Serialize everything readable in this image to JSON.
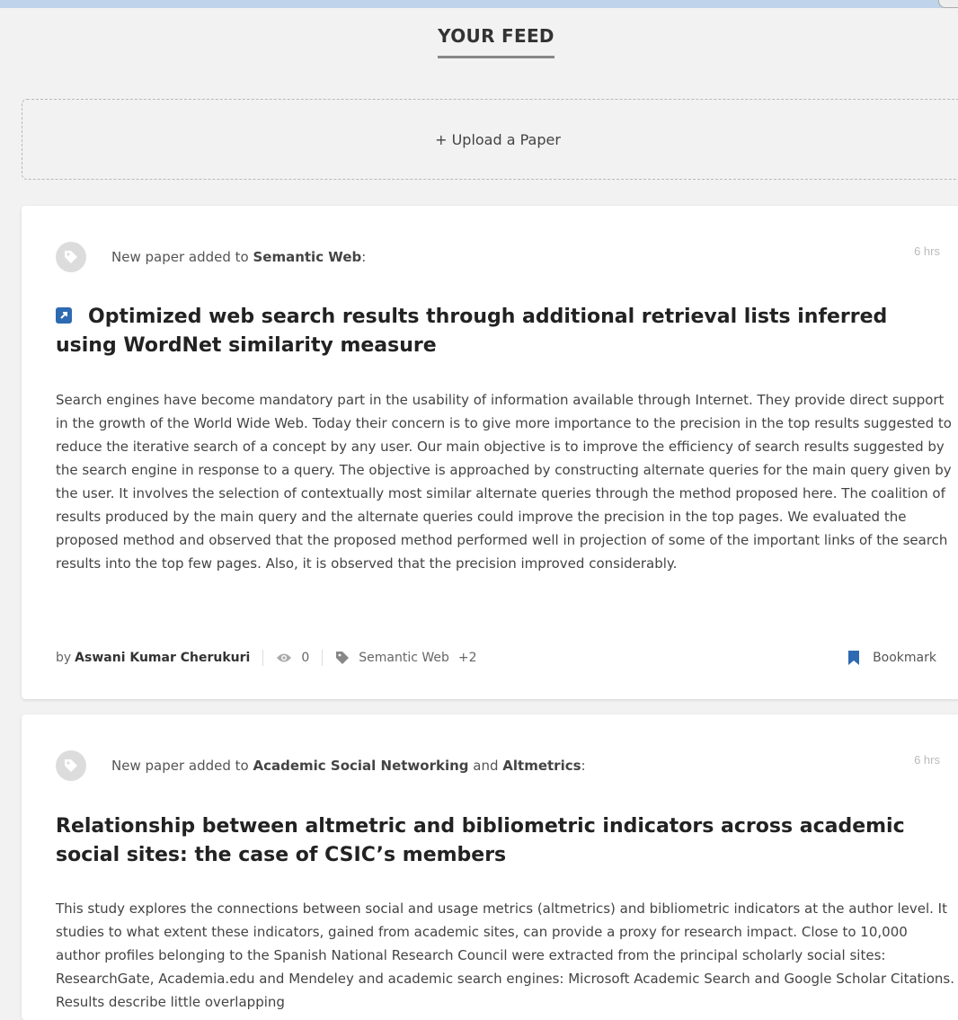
{
  "feed": {
    "title": "YOUR FEED"
  },
  "upload": {
    "label": "+ Upload a Paper"
  },
  "posts": [
    {
      "notice_prefix": "New paper added to ",
      "topics": [
        "Semantic Web"
      ],
      "notice_joiner": " and ",
      "notice_suffix": ":",
      "time": "6 hrs",
      "title": "Optimized web search results through additional retrieval lists inferred using WordNet similarity measure",
      "abstract": "Search engines have become mandatory part in the usability of information available through Internet. They provide direct support in the growth of the World Wide Web. Today their concern is to give more importance to the precision in the top results suggested to reduce the iterative search of a concept by any user. Our main objective is to improve the efficiency of search results suggested by the search engine in response to a query. The objective is approached by constructing alternate queries for the main query given by the user. It involves the selection of contextually most similar alternate queries through the method proposed here. The coalition of results produced by the main query and the alternate queries could improve the precision in the top pages. We evaluated the proposed method and observed that the proposed method performed well in projection of some of the important links of the search results into the top few pages. Also, it is observed that the precision improved considerably.",
      "by_label": "by",
      "author": "Aswani Kumar Cherukuri",
      "views": "0",
      "tag": "Semantic Web",
      "more_tags": "+2",
      "bookmark_label": "Bookmark"
    },
    {
      "notice_prefix": "New paper added to ",
      "topics": [
        "Academic Social Networking",
        "Altmetrics"
      ],
      "notice_joiner": " and ",
      "notice_suffix": ":",
      "time": "6 hrs",
      "title": "Relationship between altmetric and bibliometric indicators across academic social sites: the case of CSIC’s members",
      "abstract": "This study explores the connections between social and usage metrics (altmetrics) and bibliometric indicators at the author level. It studies to what extent these indicators, gained from academic sites, can provide a proxy for research impact. Close to 10,000 author profiles belonging to the Spanish National Research Council were extracted from the principal scholarly social sites: ResearchGate, Academia.edu and Mendeley and academic search engines: Microsoft Academic Search and Google Scholar Citations. Results describe little overlapping"
    }
  ],
  "colors": {
    "accent": "#2e6ab1",
    "background": "#f2f2f2",
    "card": "#ffffff",
    "muted": "#bbbbbb"
  },
  "icons": {
    "notice": "tag-icon",
    "external": "external-link-icon",
    "views": "eye-icon",
    "tags": "tag-icon",
    "bookmark": "bookmark-icon"
  }
}
